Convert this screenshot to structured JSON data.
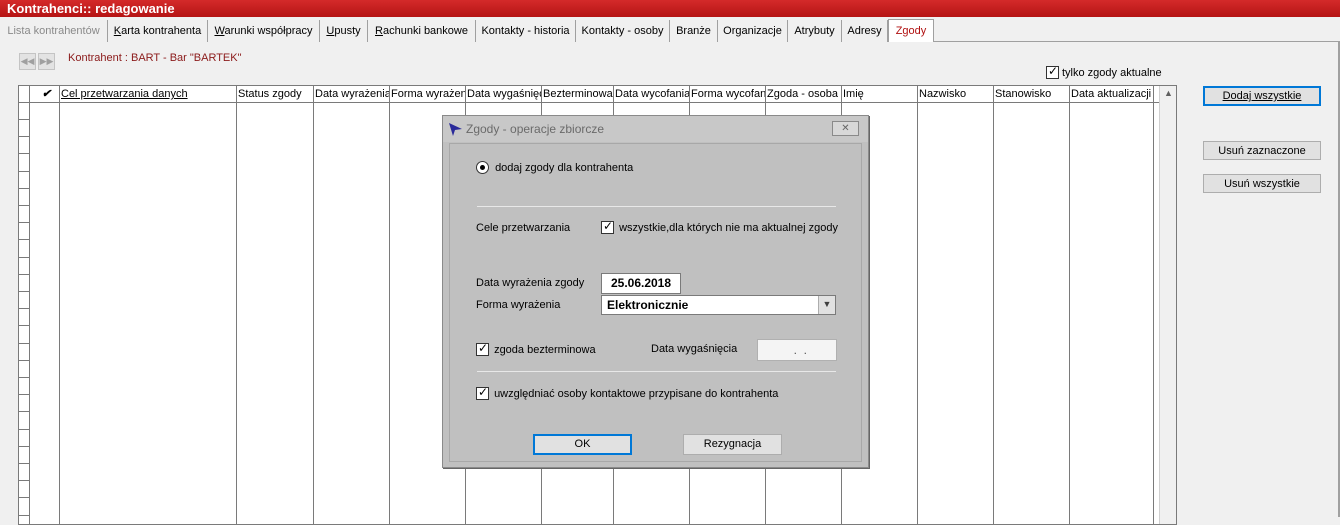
{
  "window": {
    "title": "Kontrahenci:: redagowanie"
  },
  "tabs": [
    {
      "label": "Lista kontrahentów",
      "state": "disabled"
    },
    {
      "label": "Karta kontrahenta",
      "underline_char": "K"
    },
    {
      "label": "Warunki współpracy",
      "underline_char": "W"
    },
    {
      "label": "Upusty",
      "underline_char": "U"
    },
    {
      "label": "Rachunki bankowe",
      "underline_char": "R"
    },
    {
      "label": "Kontakty - historia"
    },
    {
      "label": "Kontakty - osoby"
    },
    {
      "label": "Branże"
    },
    {
      "label": "Organizacje"
    },
    {
      "label": "Atrybuty"
    },
    {
      "label": "Adresy"
    },
    {
      "label": "Zgody",
      "state": "active"
    }
  ],
  "nav": {
    "prev_icon": "first-record-icon",
    "next_icon": "last-record-icon"
  },
  "contractor_label": "Kontrahent : BART  -  Bar \"BARTEK\"",
  "only_current": {
    "label": "tylko zgody aktualne",
    "checked": true
  },
  "grid": {
    "check_header": "✔",
    "columns": [
      "Cel przetwarzania danych",
      "Status zgody",
      "Data wyrażenia",
      "Forma wyrażenia",
      "Data wygaśnięcia",
      "Bezterminowa",
      "Data wycofania",
      "Forma wycofania",
      "Zgoda - osoba kontaktowa",
      "Imię",
      "Nazwisko",
      "Stanowisko",
      "Data aktualizacji"
    ]
  },
  "side_buttons": {
    "add_all": "Dodaj wszystkie",
    "remove_selected": "Usuń zaznaczone",
    "remove_all": "Usuń wszystkie"
  },
  "dialog": {
    "title": "Zgody - operacje zbiorcze",
    "close_icon": "close-icon",
    "radio_label": "dodaj zgody dla kontrahenta",
    "purposes_label": "Cele przetwarzania",
    "purposes_check": {
      "label": "wszystkie,dla których nie ma aktualnej zgody",
      "checked": true
    },
    "date_label": "Data wyrażenia zgody",
    "date_value": "25.06.2018",
    "form_label": "Forma wyrażenia",
    "form_value": "Elektronicznie",
    "indefinite_check": {
      "label": "zgoda bezterminowa",
      "checked": true
    },
    "expiry_label": "Data wygaśnięcia",
    "expiry_value": "  .  .",
    "contacts_check": {
      "label": "uwzględniać osoby kontaktowe przypisane do kontrahenta",
      "checked": true
    },
    "ok_label": "OK",
    "cancel_label": "Rezygnacja"
  },
  "colors": {
    "titlebar": "#c41e1e",
    "active_tab_text": "#b01010",
    "contractor_text": "#8b1a1a",
    "focus_border": "#0078d7"
  }
}
